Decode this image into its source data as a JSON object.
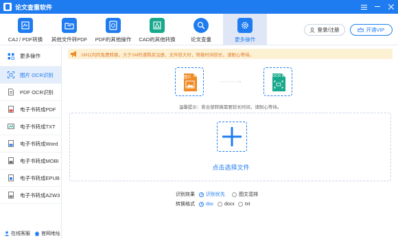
{
  "window": {
    "title": "论文查重软件",
    "menu_icon": "hamburger-icon",
    "minimize_icon": "minimize-icon",
    "close_icon": "close-icon"
  },
  "toolbar": {
    "tools": [
      {
        "label": "CAJ / PDF转换",
        "icon": "caj-pdf-icon",
        "color": "#1f7cf0"
      },
      {
        "label": "其他文件转PDF",
        "icon": "folder-pdf-icon",
        "color": "#1f7cf0"
      },
      {
        "label": "PDF的其他操作",
        "icon": "pdf-ops-icon",
        "color": "#1f7cf0"
      },
      {
        "label": "CAD的其他转换",
        "icon": "cad-icon",
        "color": "#18a88c"
      },
      {
        "label": "论文查重",
        "icon": "paper-check-icon",
        "color": "#1f7cf0"
      },
      {
        "label": "更多操作",
        "icon": "gear-icon",
        "color": "#1f7cf0",
        "active": true
      }
    ],
    "login_label": "登录/注册",
    "vip_label": "开通VIP"
  },
  "sidebar": {
    "header": "更多操作",
    "items": [
      {
        "label": "图片 OCR识别",
        "icon": "image-ocr-icon",
        "active": true
      },
      {
        "label": "PDF OCR识别",
        "icon": "pdf-ocr-icon"
      },
      {
        "label": "电子书转成PDF",
        "icon": "ebook-pdf-icon"
      },
      {
        "label": "电子书转成TXT",
        "icon": "ebook-txt-icon"
      },
      {
        "label": "电子书转成Word",
        "icon": "ebook-word-icon"
      },
      {
        "label": "电子书转成MOBI",
        "icon": "ebook-mobi-icon"
      },
      {
        "label": "电子书转成EPUB",
        "icon": "ebook-epub-icon"
      },
      {
        "label": "电子书转成AZW3",
        "icon": "ebook-azw3-icon"
      }
    ],
    "footer": {
      "support": "在线客服",
      "website": "官网地址"
    }
  },
  "main": {
    "notice": "1M以内的免费转换，大于1M的请购买注册，文件较大时，转换时间较长，请耐心等待。",
    "flow": {
      "from_label": "图片",
      "to_label": "OCR"
    },
    "hint": "温馨提示：若全部转换需要较长时间，请耐心等待。",
    "drop_label": "点击选择文件",
    "options": {
      "recognition": {
        "label": "识别效果",
        "choices": [
          "识别优先",
          "图文混排"
        ],
        "selected": "识别优先"
      },
      "format": {
        "label": "转换格式",
        "choices": [
          "doc",
          "docx",
          "txt"
        ],
        "selected": "doc"
      }
    }
  },
  "colors": {
    "accent": "#1f7cf0",
    "notice_bg": "#fdf1d3",
    "notice_text": "#e07a2c",
    "orange": "#f08a24",
    "teal": "#18a88c"
  }
}
